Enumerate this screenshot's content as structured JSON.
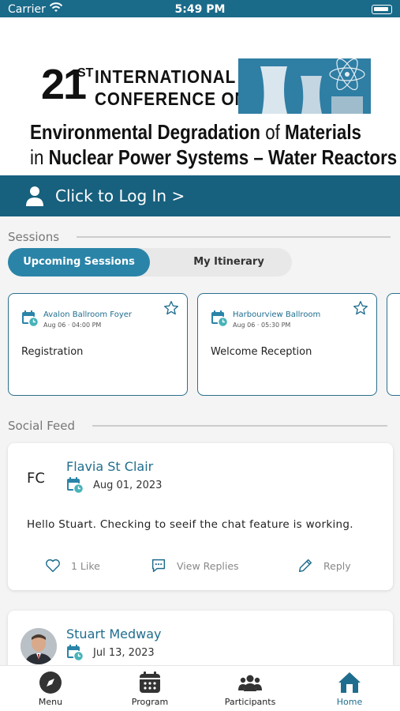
{
  "status_bar": {
    "carrier": "Carrier",
    "time": "5:49 PM"
  },
  "banner": {
    "number": "21",
    "ordinal": "ST",
    "line1": "INTERNATIONAL",
    "line2": "CONFERENCE ON",
    "title1_a": "Environmental Degradation ",
    "title1_b": "of",
    "title1_c": " Materials",
    "title2_a": "in",
    "title2_b": " Nuclear Power Systems – Water Reactors"
  },
  "login": {
    "label": "Click to Log In >"
  },
  "sessions": {
    "heading": "Sessions",
    "tabs": [
      {
        "label": "Upcoming Sessions",
        "active": true
      },
      {
        "label": "My Itinerary",
        "active": false
      }
    ],
    "cards": [
      {
        "location": "Avalon Ballroom Foyer",
        "when": "Aug 06 · 04:00 PM",
        "name": "Registration"
      },
      {
        "location": "Harbourview Ballroom",
        "when": "Aug 06 · 05:30 PM",
        "name": "Welcome Reception"
      }
    ]
  },
  "social_feed": {
    "heading": "Social Feed",
    "posts": [
      {
        "initials": "FC",
        "author": "Flavia St Clair",
        "date": "Aug 01, 2023",
        "body": "Hello Stuart. Checking to seeif the chat feature is working.",
        "like_label": "1 Like",
        "replies_label": "View Replies",
        "reply_label": "Reply"
      },
      {
        "author": "Stuart Medway",
        "date": "Jul 13, 2023"
      }
    ]
  },
  "bottom_nav": {
    "items": [
      {
        "label": "Menu",
        "icon": "compass-icon"
      },
      {
        "label": "Program",
        "icon": "calendar-grid-icon"
      },
      {
        "label": "Participants",
        "icon": "people-icon"
      },
      {
        "label": "Home",
        "icon": "home-icon",
        "active": true
      }
    ]
  },
  "colors": {
    "primary": "#17607e",
    "accent": "#2a84a8",
    "link": "#1f6d8e"
  }
}
